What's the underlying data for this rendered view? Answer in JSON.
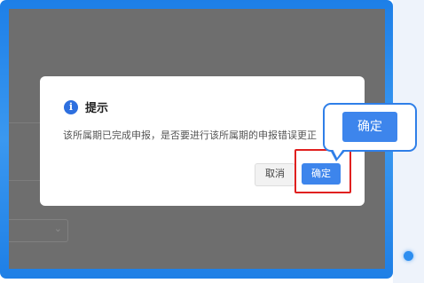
{
  "dialog": {
    "title": "提示",
    "message": "该所属期已完成申报，是否要进行该所属期的申报错误更正",
    "cancel_label": "取消",
    "ok_label": "确定"
  },
  "callout": {
    "label": "确定"
  },
  "colors": {
    "frame_blue": "#2d8ef0",
    "primary_button": "#3d85ec",
    "highlight_red": "#e0201f",
    "overlay_gray": "#6e6e6e"
  }
}
